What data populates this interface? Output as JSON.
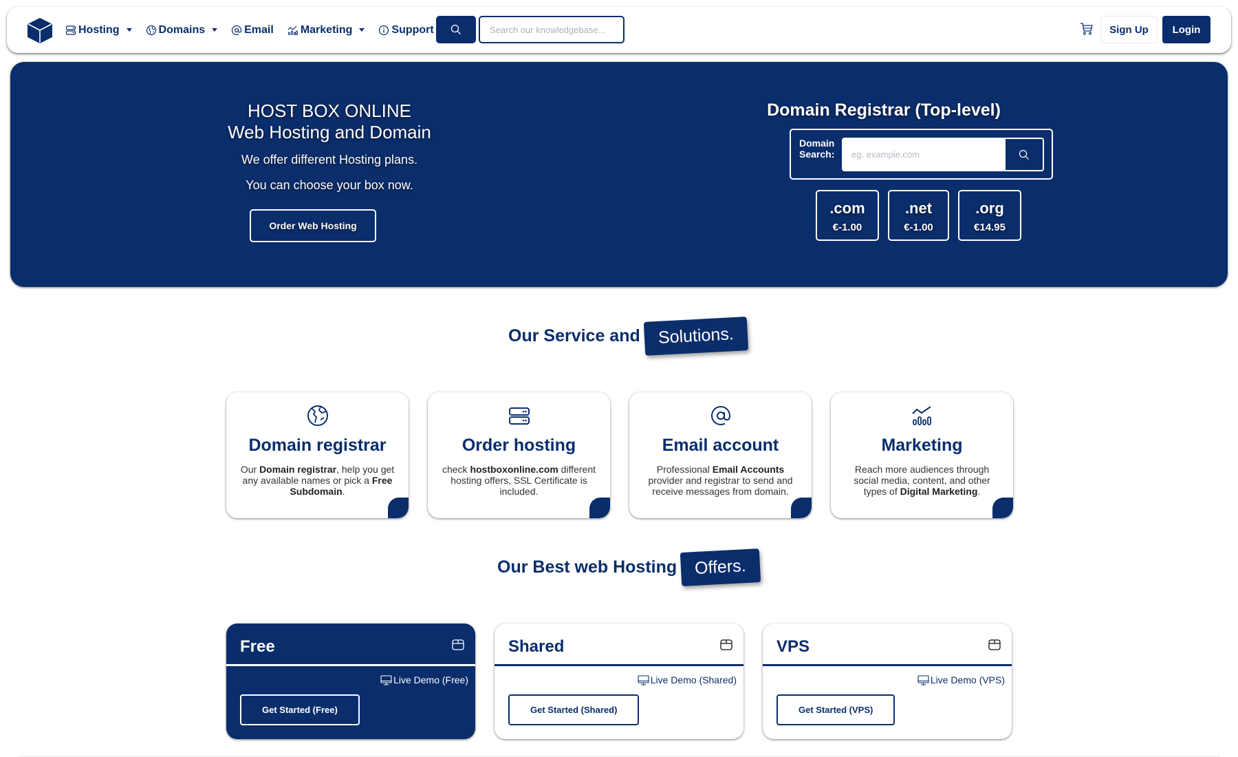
{
  "colors": {
    "primary": "#0a2d6b",
    "background": "#ffffff",
    "text": "#333333"
  },
  "navbar": {
    "logo": "cube-logo",
    "items": [
      {
        "label": "Hosting",
        "icon": "server-icon",
        "dropdown": true
      },
      {
        "label": "Domains",
        "icon": "globe-icon",
        "dropdown": true
      },
      {
        "label": "Email",
        "icon": "at-icon",
        "dropdown": false
      },
      {
        "label": "Marketing",
        "icon": "chart-icon",
        "dropdown": true
      },
      {
        "label": "Support",
        "icon": "info-icon",
        "dropdown": true
      }
    ],
    "search": {
      "placeholder": "Search our knowledgebase...",
      "value": ""
    },
    "cart_icon": "cart-icon",
    "signup_label": "Sign Up",
    "login_label": "Login"
  },
  "hero": {
    "title_line1": "HOST BOX ONLINE",
    "title_line2": "Web Hosting and Domain",
    "subtitle1": "We offer different Hosting plans.",
    "subtitle2": "You can choose your box now.",
    "order_button": "Order Web Hosting",
    "domain": {
      "title": "Domain Registrar (Top-level)",
      "label_line1": "Domain",
      "label_line2": "Search:",
      "placeholder": "eg. example.com",
      "value": "",
      "tlds": [
        {
          "ext": ".com",
          "price": "€-1.00"
        },
        {
          "ext": ".net",
          "price": "€-1.00"
        },
        {
          "ext": ".org",
          "price": "€14.95"
        }
      ]
    }
  },
  "services": {
    "heading": "Our Service and",
    "badge": "Solutions.",
    "cards": [
      {
        "icon": "globe-icon",
        "title": "Domain registrar",
        "desc": [
          [
            "Our ",
            false
          ],
          [
            "Domain registrar",
            true
          ],
          [
            ", help you get any available names or pick a ",
            false
          ],
          [
            "Free Subdomain",
            true
          ],
          [
            ".",
            false
          ]
        ]
      },
      {
        "icon": "server-icon",
        "title": "Order hosting",
        "desc": [
          [
            "check ",
            false
          ],
          [
            "hostboxonline.com",
            true
          ],
          [
            " different hosting offers, SSL Certificate is included.",
            false
          ]
        ]
      },
      {
        "icon": "at-icon",
        "title": "Email account",
        "desc": [
          [
            "Professional ",
            false
          ],
          [
            "Email Accounts",
            true
          ],
          [
            " provider and registrar to send and receive messages from domain.",
            false
          ]
        ]
      },
      {
        "icon": "chart-icon",
        "title": "Marketing",
        "desc": [
          [
            "Reach more audiences through social media, content, and other types of ",
            false
          ],
          [
            "Digital Marketing",
            true
          ],
          [
            ".",
            false
          ]
        ]
      }
    ]
  },
  "offers": {
    "heading": "Our Best web Hosting",
    "badge": "Offers.",
    "cards": [
      {
        "name": "Free",
        "live_demo": "Live Demo (Free)",
        "button": "Get Started (Free)",
        "highlighted": true
      },
      {
        "name": "Shared",
        "live_demo": "Live Demo (Shared)",
        "button": "Get Started (Shared)",
        "highlighted": false
      },
      {
        "name": "VPS",
        "live_demo": "Live Demo (VPS)",
        "button": "Get Started (VPS)",
        "highlighted": false
      }
    ]
  }
}
